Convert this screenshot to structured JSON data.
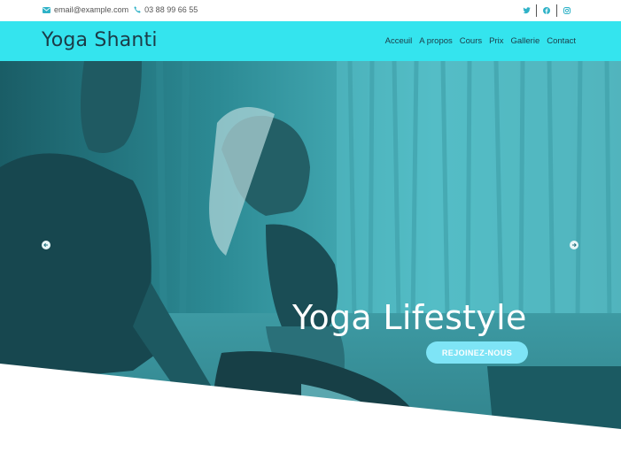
{
  "topbar": {
    "email": "email@example.com",
    "phone": "03 88 99 66 55",
    "icons": [
      "envelope-icon",
      "phone-icon",
      "twitter-icon",
      "facebook-icon",
      "instagram-icon"
    ]
  },
  "navbar": {
    "brand": "Yoga Shanti",
    "items": [
      {
        "label": "Acceuil"
      },
      {
        "label": "A propos"
      },
      {
        "label": "Cours"
      },
      {
        "label": "Prix"
      },
      {
        "label": "Gallerie"
      },
      {
        "label": "Contact"
      }
    ]
  },
  "hero": {
    "headline": "Yoga Lifestyle",
    "cta_label": "REJOINEZ-NOUS",
    "prev_icon": "arrow-left-icon",
    "next_icon": "arrow-right-icon"
  },
  "colors": {
    "navbar_bg": "#34e4ee",
    "accent": "#2fb2c7",
    "brand_text": "#1c3b47",
    "cta_bg": "#7ee4f6"
  }
}
